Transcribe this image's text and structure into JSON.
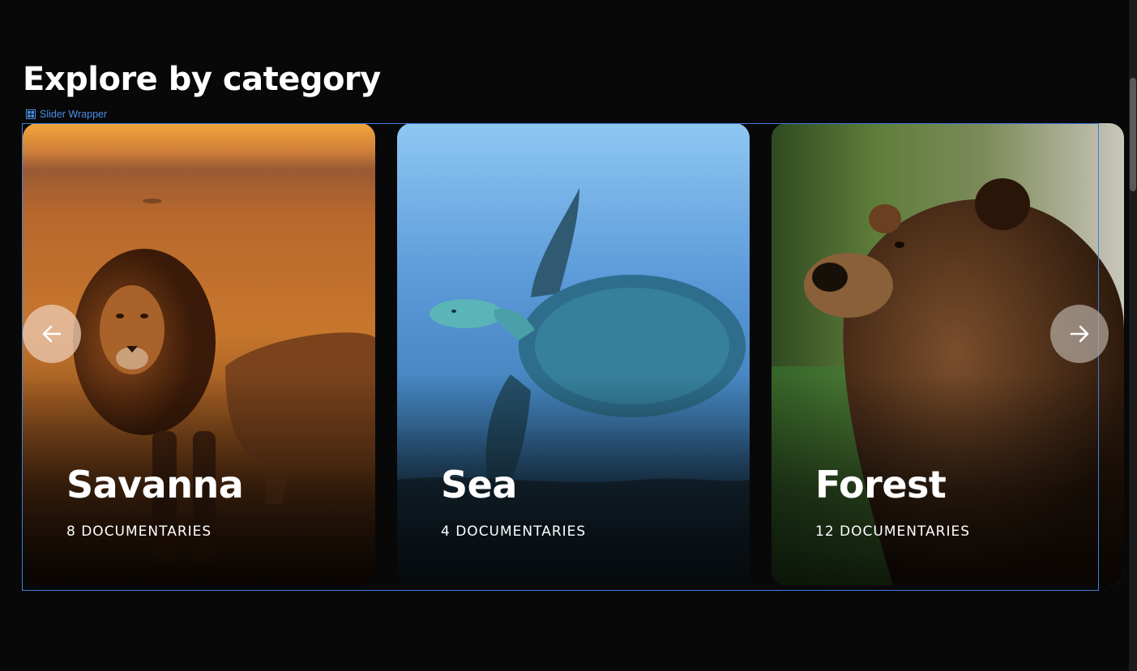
{
  "section": {
    "title": "Explore by category"
  },
  "slider": {
    "wrapper_label": "Slider Wrapper",
    "wrapper_icon": "grid-icon",
    "prev_icon": "arrow-left-icon",
    "next_icon": "arrow-right-icon",
    "cards": [
      {
        "title": "Savanna",
        "count": "8 DOCUMENTARIES",
        "image": "lion-photo"
      },
      {
        "title": "Sea",
        "count": "4 DOCUMENTARIES",
        "image": "sea-turtle-photo"
      },
      {
        "title": "Forest",
        "count": "12 DOCUMENTARIES",
        "image": "brown-bear-photo"
      }
    ]
  },
  "colors": {
    "background": "#080809",
    "wrapper_outline": "#3d7fd6",
    "text": "#ffffff"
  }
}
